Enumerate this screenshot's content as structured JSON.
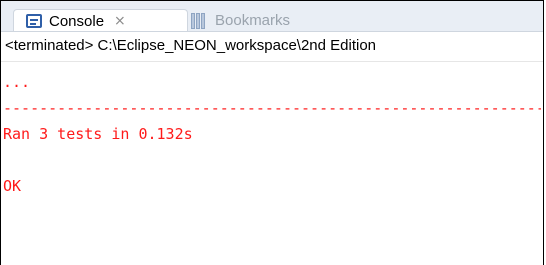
{
  "tabs": {
    "console_label": "Console",
    "console_close": "⨯",
    "bookmarks_label": "Bookmarks"
  },
  "status": {
    "text": "<terminated> C:\\Eclipse_NEON_workspace\\2nd Edition"
  },
  "output": {
    "lines": [
      "...",
      "----------------------------------------------------------------------",
      "Ran 3 tests in 0.132s",
      "",
      "OK"
    ]
  },
  "colors": {
    "output_text": "#ff1a1a",
    "icon_accent": "#2f5fa8"
  },
  "icons": {
    "console": "console-icon",
    "close": "close-icon",
    "bookmarks": "bookmarks-icon"
  }
}
